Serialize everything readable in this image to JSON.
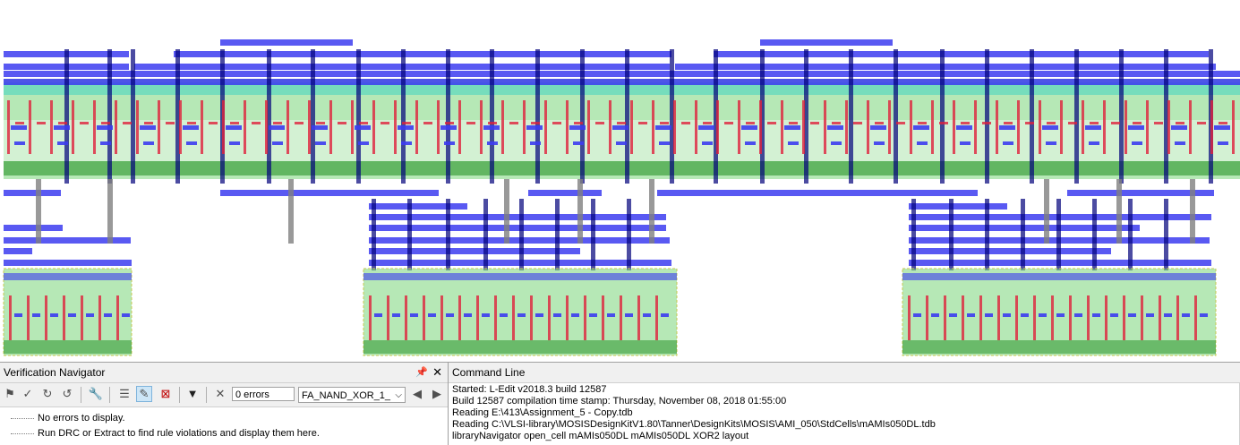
{
  "verification_navigator": {
    "title": "Verification Navigator",
    "pin_icon": "pin-icon",
    "close_icon": "close-icon",
    "errors_field": "0 errors",
    "cell_select": "FA_NAND_XOR_1_",
    "messages": [
      "No errors to display.",
      "Run DRC or Extract to find rule violations and display them here."
    ],
    "toolbar_icons": [
      "marker-icon",
      "check-icon",
      "redo-icon",
      "undo-icon",
      "wrench-icon",
      "list-icon",
      "highlight-icon",
      "select-box-icon",
      "dropdown-icon",
      "delete-icon",
      "prev-arrow-icon",
      "next-arrow-icon"
    ]
  },
  "command_line": {
    "title": "Command Line",
    "lines": [
      "Started: L-Edit v2018.3 build 12587",
      "Build 12587 compilation time stamp: Thursday, November 08, 2018 01:55:00",
      "Reading E:\\413\\Assignment_5 - Copy.tdb",
      "Reading C:\\VLSI-library\\MOSISDesignKitV1.80\\Tanner\\DesignKits\\MOSIS\\AMI_050\\StdCells\\mAMIs050DL.tdb",
      "libraryNavigator open_cell mAMIs050DL mAMIs050DL XOR2 layout"
    ]
  },
  "layout_view": {
    "colors": {
      "metal1": "#3c3cf0",
      "metal2_dark": "#00007a",
      "poly": "#e0203c",
      "active": "#1e8c1e",
      "select": "#7ad67a",
      "via": "#808080",
      "well_border": "#c8c850",
      "cyan": "#00c8c8"
    }
  }
}
